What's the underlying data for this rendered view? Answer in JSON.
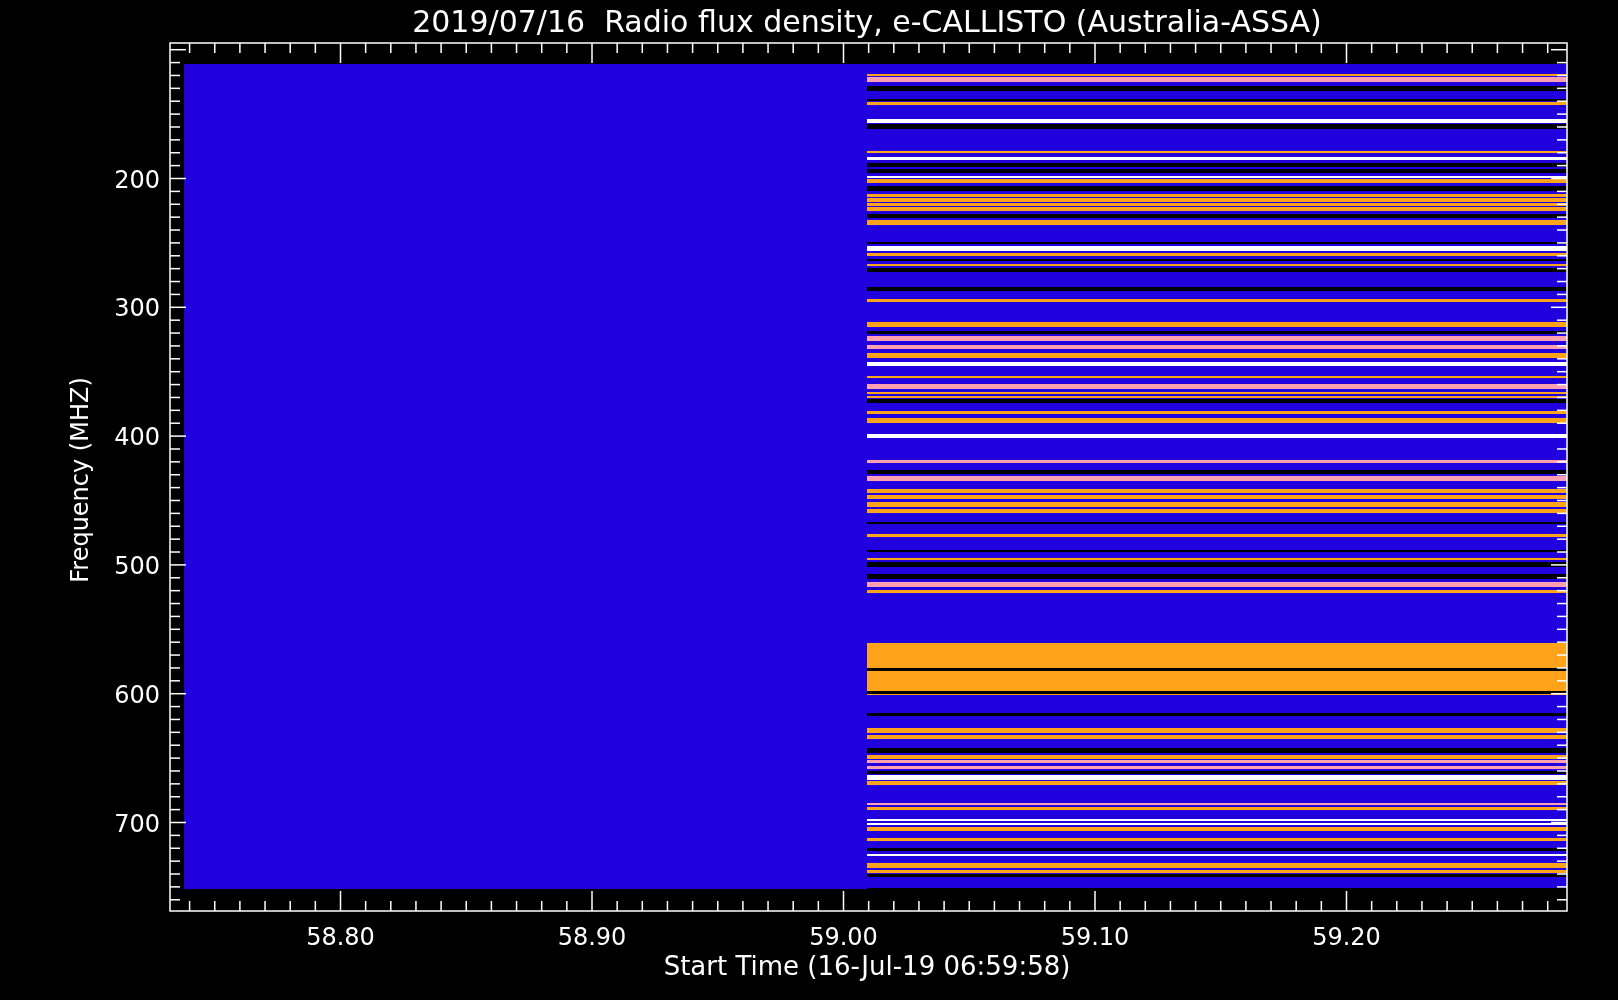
{
  "title": "2019/07/16  Radio flux density, e-CALLISTO (Australia-ASSA)",
  "plot": {
    "xlabel": "Start Time (16-Jul-19 06:59:58)",
    "ylabel": "Frequency (MHZ)",
    "xticks": [
      "58.80",
      "58.90",
      "59.00",
      "59.10",
      "59.20"
    ],
    "yticks": [
      "200",
      "300",
      "400",
      "500",
      "600",
      "700"
    ]
  }
}
